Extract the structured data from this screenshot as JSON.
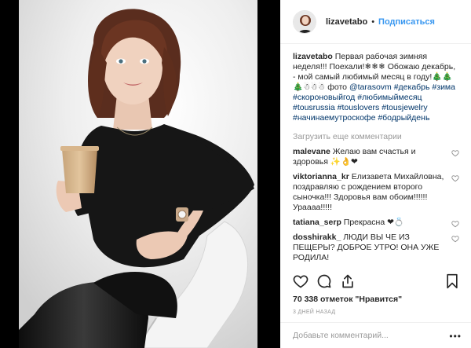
{
  "post": {
    "username": "lizavetabo",
    "follow_label": "Подписаться",
    "separator": "•"
  },
  "caption": {
    "username": "lizavetabo",
    "text": "Первая рабочая зимняя неделя!!! Поехали!❄❄❄ Обожаю декабрь, - мой самый любимый месяц в году!🎄🎄🎄☃☃☃ фото ",
    "mention": "@tarasovm",
    "hashtags": "#декабрь #зима #скороновыйгод #любимыймесяц #tousrussia #touslovers #tousjewelry #начинаемутроскофе #бодрыйдень"
  },
  "load_more_label": "Загрузить еще комментарии",
  "comments": [
    {
      "user": "malevane",
      "text": "Желаю вам счастья и здоровья ✨👌❤"
    },
    {
      "user": "viktorianna_kr",
      "text": "Елизавета Михайловна, поздравляю с рождением второго сыночка!!! Здоровья вам обоим!!!!!! Ураааа!!!!!"
    },
    {
      "user": "tatiana_serp",
      "text": "Прекрасна ❤💍"
    },
    {
      "user": "dosshirakk_",
      "text": "ЛЮДИ ВЫ ЧЕ ИЗ ПЕЩЕРЫ? ДОБРОЕ УТРО! ОНА УЖЕ РОДИЛА!"
    }
  ],
  "likes_text": "70 338 отметок \"Нравится\"",
  "time_text": "3 ДНЕЙ НАЗАД",
  "add_comment_placeholder": "Добавьте комментарий...",
  "more_label": "•••",
  "icons": {
    "like": "heart-outline-icon",
    "comment": "speech-bubble-icon",
    "share": "share-arrow-icon",
    "save": "bookmark-icon",
    "comment_like": "small-heart-icon"
  },
  "colors": {
    "link_blue": "#3897f0",
    "hashtag": "#003569",
    "muted": "#999999",
    "text": "#262626"
  }
}
